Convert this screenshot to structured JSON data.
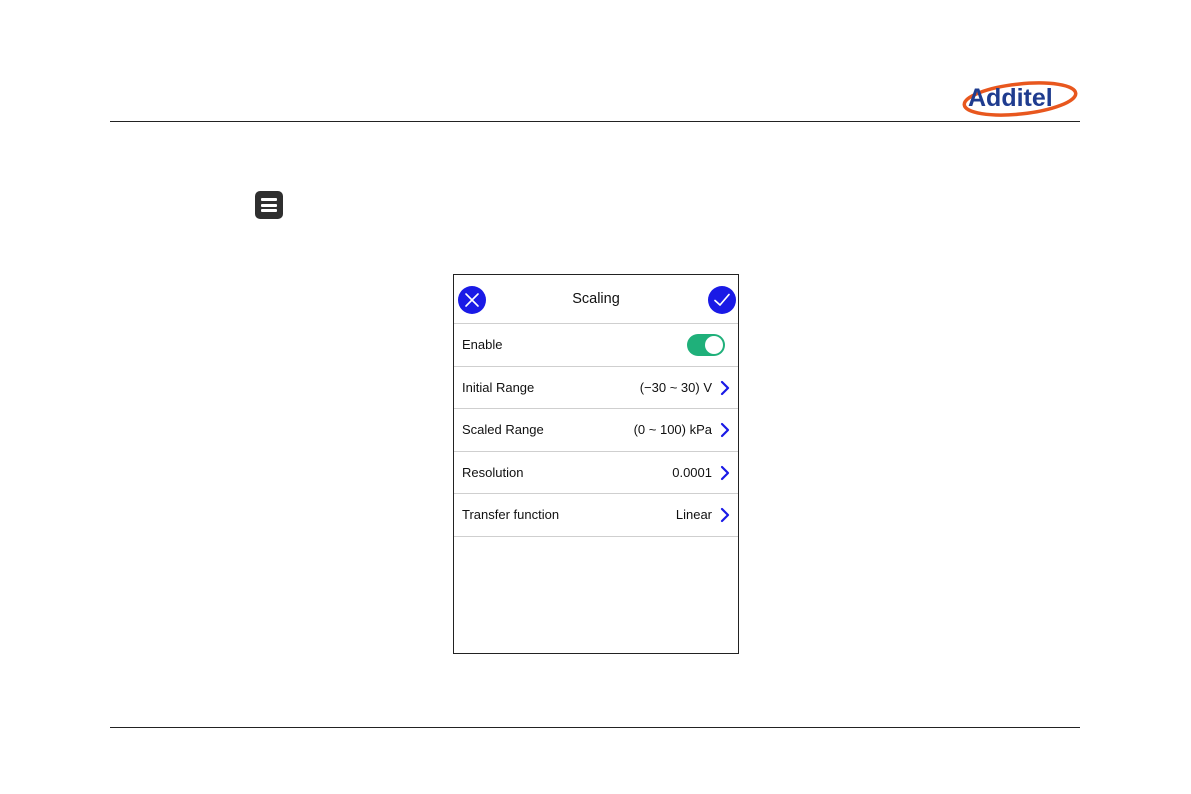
{
  "brand": {
    "logo_text": "Additel",
    "logo_color": "#1f3c8f",
    "swoosh_color": "#e8571e"
  },
  "toolbar": {
    "icon": "menu-icon"
  },
  "dialog": {
    "title": "Scaling",
    "cancel_icon": "close-icon",
    "confirm_icon": "check-icon",
    "accent_color": "#1a1ae6",
    "rows": [
      {
        "label": "Enable",
        "type": "toggle",
        "on": true,
        "toggle_color": "#1fb07a"
      },
      {
        "label": "Initial Range",
        "value": "(−30 ~ 30) V",
        "icon": "chevron-right-icon"
      },
      {
        "label": "Scaled Range",
        "value": "(0 ~ 100) kPa",
        "icon": "chevron-right-icon"
      },
      {
        "label": "Resolution",
        "value": "0.0001",
        "icon": "chevron-right-icon"
      },
      {
        "label": "Transfer function",
        "value": "Linear",
        "icon": "chevron-right-icon"
      }
    ]
  }
}
